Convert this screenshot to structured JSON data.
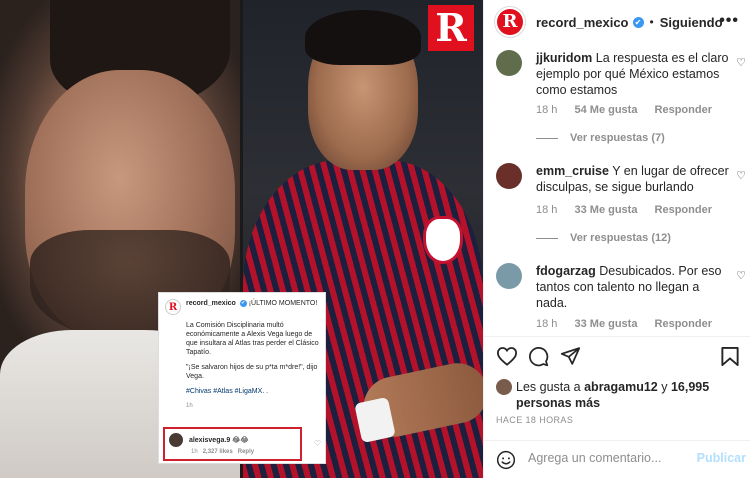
{
  "embedded_image": {
    "logo_letter": "R",
    "card": {
      "avatar_letter": "R",
      "username": "record_mexico",
      "verified_glyph": "✔",
      "headline": "¡ÚLTIMO MOMENTO!",
      "paragraph1": "La Comisión Disciplinaria multó económicamente a Alexis Vega luego de que insultara al Atlas tras perder el Clásico Tapatío.",
      "paragraph2": "\"¡Se salvaron hijos de su p*ta m*dre!\", dijo Vega.",
      "hashtags": "#Chivas #Atlas #LigaMX. .",
      "time": "1h",
      "reply": {
        "username": "alexisvega.9",
        "emojis": "😂😂",
        "time": "1h",
        "likes": "2,327 likes",
        "reply_label": "Reply"
      }
    }
  },
  "header": {
    "avatar_letter": "R",
    "username": "record_mexico",
    "verified_glyph": "✔",
    "separator": "•",
    "follow_status": "Siguiendo",
    "more": "•••"
  },
  "comments": [
    {
      "username": "jjkuridom",
      "text": "La respuesta es el claro ejemplo por qué México estamos como estamos",
      "time": "18 h",
      "likes": "54 Me gusta",
      "reply_label": "Responder",
      "view_replies": "Ver respuestas (7)",
      "avatar_color": "#5f6d4c"
    },
    {
      "username": "emm_cruise",
      "text": "Y en lugar de ofrecer disculpas, se sigue burlando",
      "time": "18 h",
      "likes": "33 Me gusta",
      "reply_label": "Responder",
      "view_replies": "Ver respuestas (12)",
      "avatar_color": "#6b2f2a"
    },
    {
      "username": "fdogarzag",
      "text": "Desubicados. Por eso tantos con talento no llegan a nada.",
      "time": "18 h",
      "likes": "33 Me gusta",
      "reply_label": "Responder",
      "avatar_color": "#7a9aa8"
    }
  ],
  "likes": {
    "prefix": "Les gusta a ",
    "user": "abragamu12",
    "middle": " y ",
    "count": "16,995 personas más"
  },
  "post_time": "HACE 18 HORAS",
  "composer": {
    "placeholder": "Agrega un comentario...",
    "publish_label": "Publicar"
  },
  "icons": [
    "heart-icon",
    "comment-icon",
    "share-icon",
    "save-icon",
    "emoji-icon",
    "more-icon",
    "verified-icon"
  ]
}
